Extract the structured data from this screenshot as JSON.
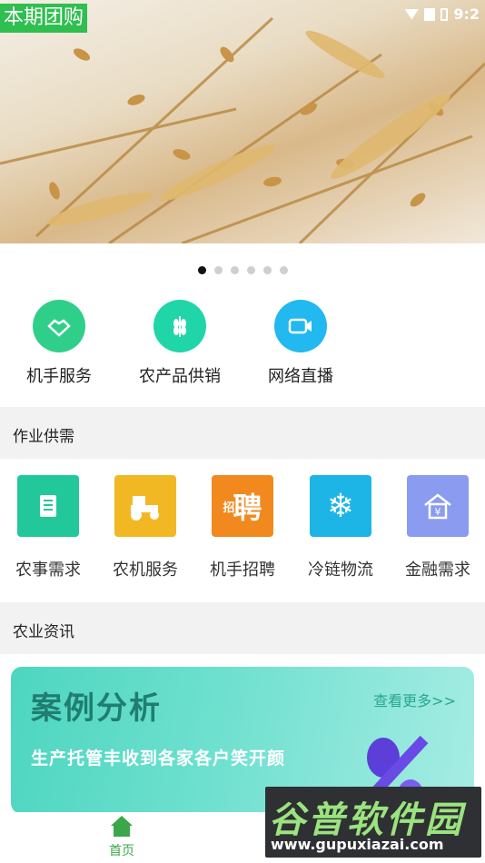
{
  "banner": {
    "tag": "本期团购",
    "status_time": "9:2"
  },
  "carousel": {
    "count": 6,
    "active": 0
  },
  "quick_actions": [
    {
      "label": "机手服务",
      "icon": "handshake-icon",
      "color": "#2fcf8a"
    },
    {
      "label": "农产品供销",
      "icon": "wheat-icon",
      "color": "#20d6a8"
    },
    {
      "label": "网络直播",
      "icon": "video-camera-icon",
      "color": "#22b8f0"
    }
  ],
  "section_supply": {
    "title": "作业供需"
  },
  "supply_items": [
    {
      "label": "农事需求",
      "icon": "document-icon",
      "color": "#22c79a"
    },
    {
      "label": "农机服务",
      "icon": "tractor-icon",
      "color": "#f2b824"
    },
    {
      "label": "机手招聘",
      "icon": "recruit-icon",
      "icon_text": "聘",
      "icon_small_text": "招",
      "color": "#f2891f"
    },
    {
      "label": "冷链物流",
      "icon": "snowflake-icon",
      "color": "#1db4e6"
    },
    {
      "label": "金融需求",
      "icon": "finance-house-icon",
      "color": "#8a9bf0"
    }
  ],
  "section_news": {
    "title": "农业资讯"
  },
  "news_card": {
    "title": "案例分析",
    "more": "查看更多>>",
    "subtitle": "生产托管丰收到各家各户笑开颜"
  },
  "bottom_nav": {
    "home_label": "首页",
    "home_color": "#3aa74a"
  },
  "watermark": {
    "big": "谷普软件园",
    "small": "www.gupuxiazai.com"
  }
}
